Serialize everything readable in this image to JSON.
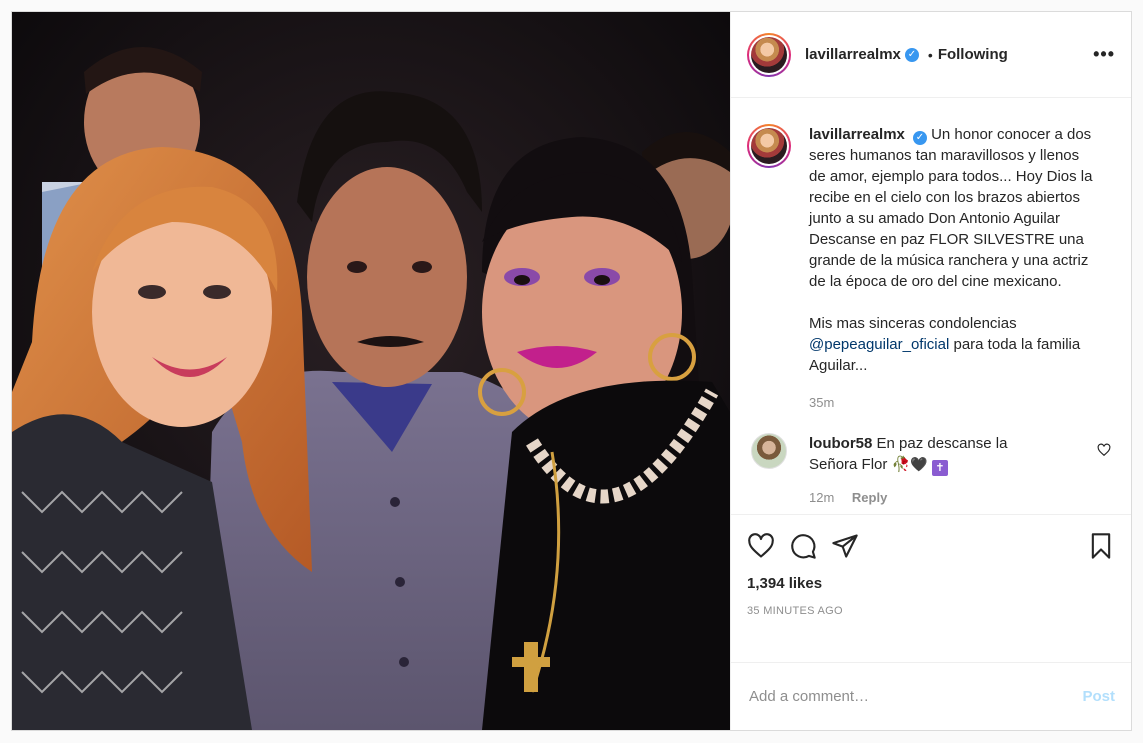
{
  "post": {
    "username": "lavillarrealmx",
    "follow_sep": "•",
    "follow_status": "Following",
    "more_label": "•••",
    "verified_glyph": "✓"
  },
  "caption": {
    "username": "lavillarrealmx",
    "text": "Un honor conocer a dos seres humanos tan maravillosos y llenos de amor, ejemplo para todos... Hoy Dios la recibe en el cielo con los brazos abiertos junto a su amado Don Antonio Aguilar Descanse en paz FLOR SILVESTRE una grande de la música ranchera y una actriz de la época de oro del cine mexicano.",
    "text2_pre": "Mis mas sinceras condolencias ",
    "mention": "@pepeaguilar_oficial",
    "text2_post": " para toda la familia Aguilar...",
    "time": "35m"
  },
  "comment": {
    "username": "loubor58",
    "text": "En paz descanse la Señora Flor ",
    "emoji1": "🥀",
    "emoji2": "🖤",
    "emoji3": "✝",
    "time": "12m",
    "reply_label": "Reply"
  },
  "icons": {
    "like": "heart-icon",
    "comment": "comment-icon",
    "share": "share-icon",
    "save": "bookmark-icon"
  },
  "engagement": {
    "likes": "1,394 likes",
    "time_ago": "35 MINUTES AGO"
  },
  "composer": {
    "placeholder": "Add a comment…",
    "post_label": "Post"
  },
  "colors": {
    "accent_link": "#00376b",
    "verified": "#3897f0",
    "post_disabled": "#b2dffc"
  }
}
